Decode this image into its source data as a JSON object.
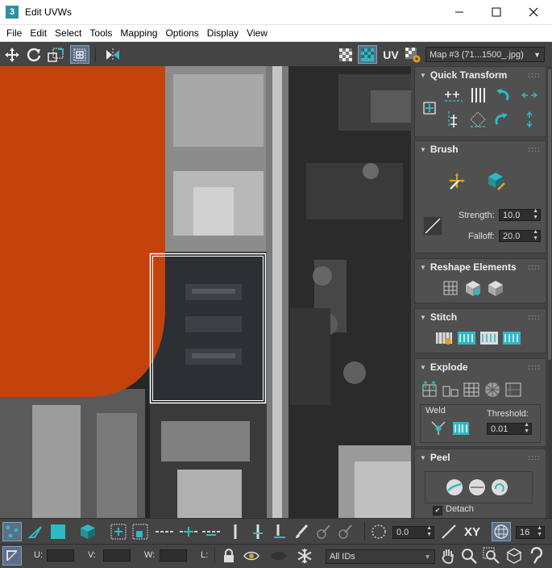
{
  "window": {
    "title": "Edit UVWs",
    "app_icon_text": "3",
    "minimize_glyph": "—",
    "maximize_glyph": "☐",
    "close_glyph": "✕"
  },
  "menu": [
    "File",
    "Edit",
    "Select",
    "Tools",
    "Mapping",
    "Options",
    "Display",
    "View"
  ],
  "toolbar_top": {
    "uv_label": "UV",
    "map_dropdown": "Map #3 (71...1500_.jpg)",
    "dropdown_arrow": "▼"
  },
  "panel": {
    "quick_transform": {
      "title": "Quick Transform"
    },
    "brush": {
      "title": "Brush",
      "strength_label": "Strength:",
      "strength_value": "10.0",
      "falloff_label": "Falloff:",
      "falloff_value": "20.0"
    },
    "reshape": {
      "title": "Reshape Elements"
    },
    "stitch": {
      "title": "Stitch"
    },
    "explode": {
      "title": "Explode",
      "weld_label": "Weld",
      "threshold_label": "Threshold:",
      "threshold_value": "0.01"
    },
    "peel": {
      "title": "Peel",
      "detach_label": "Detach",
      "detach_checked": true,
      "check_glyph": "✔"
    },
    "grip": "::::",
    "collapse_glyph": "▼"
  },
  "toolbar_bottom": {
    "rotate_value": "0.0",
    "xy_label": "XY",
    "grid_value": "16"
  },
  "status": {
    "u_label": "U:",
    "v_label": "V:",
    "w_label": "W:",
    "l_label": "L:",
    "ids_dropdown": "All IDs"
  },
  "colors": {
    "accent_cyan": "#30b8c4",
    "orange_texture": "#c4420c",
    "selection_border": "#ffffff"
  }
}
